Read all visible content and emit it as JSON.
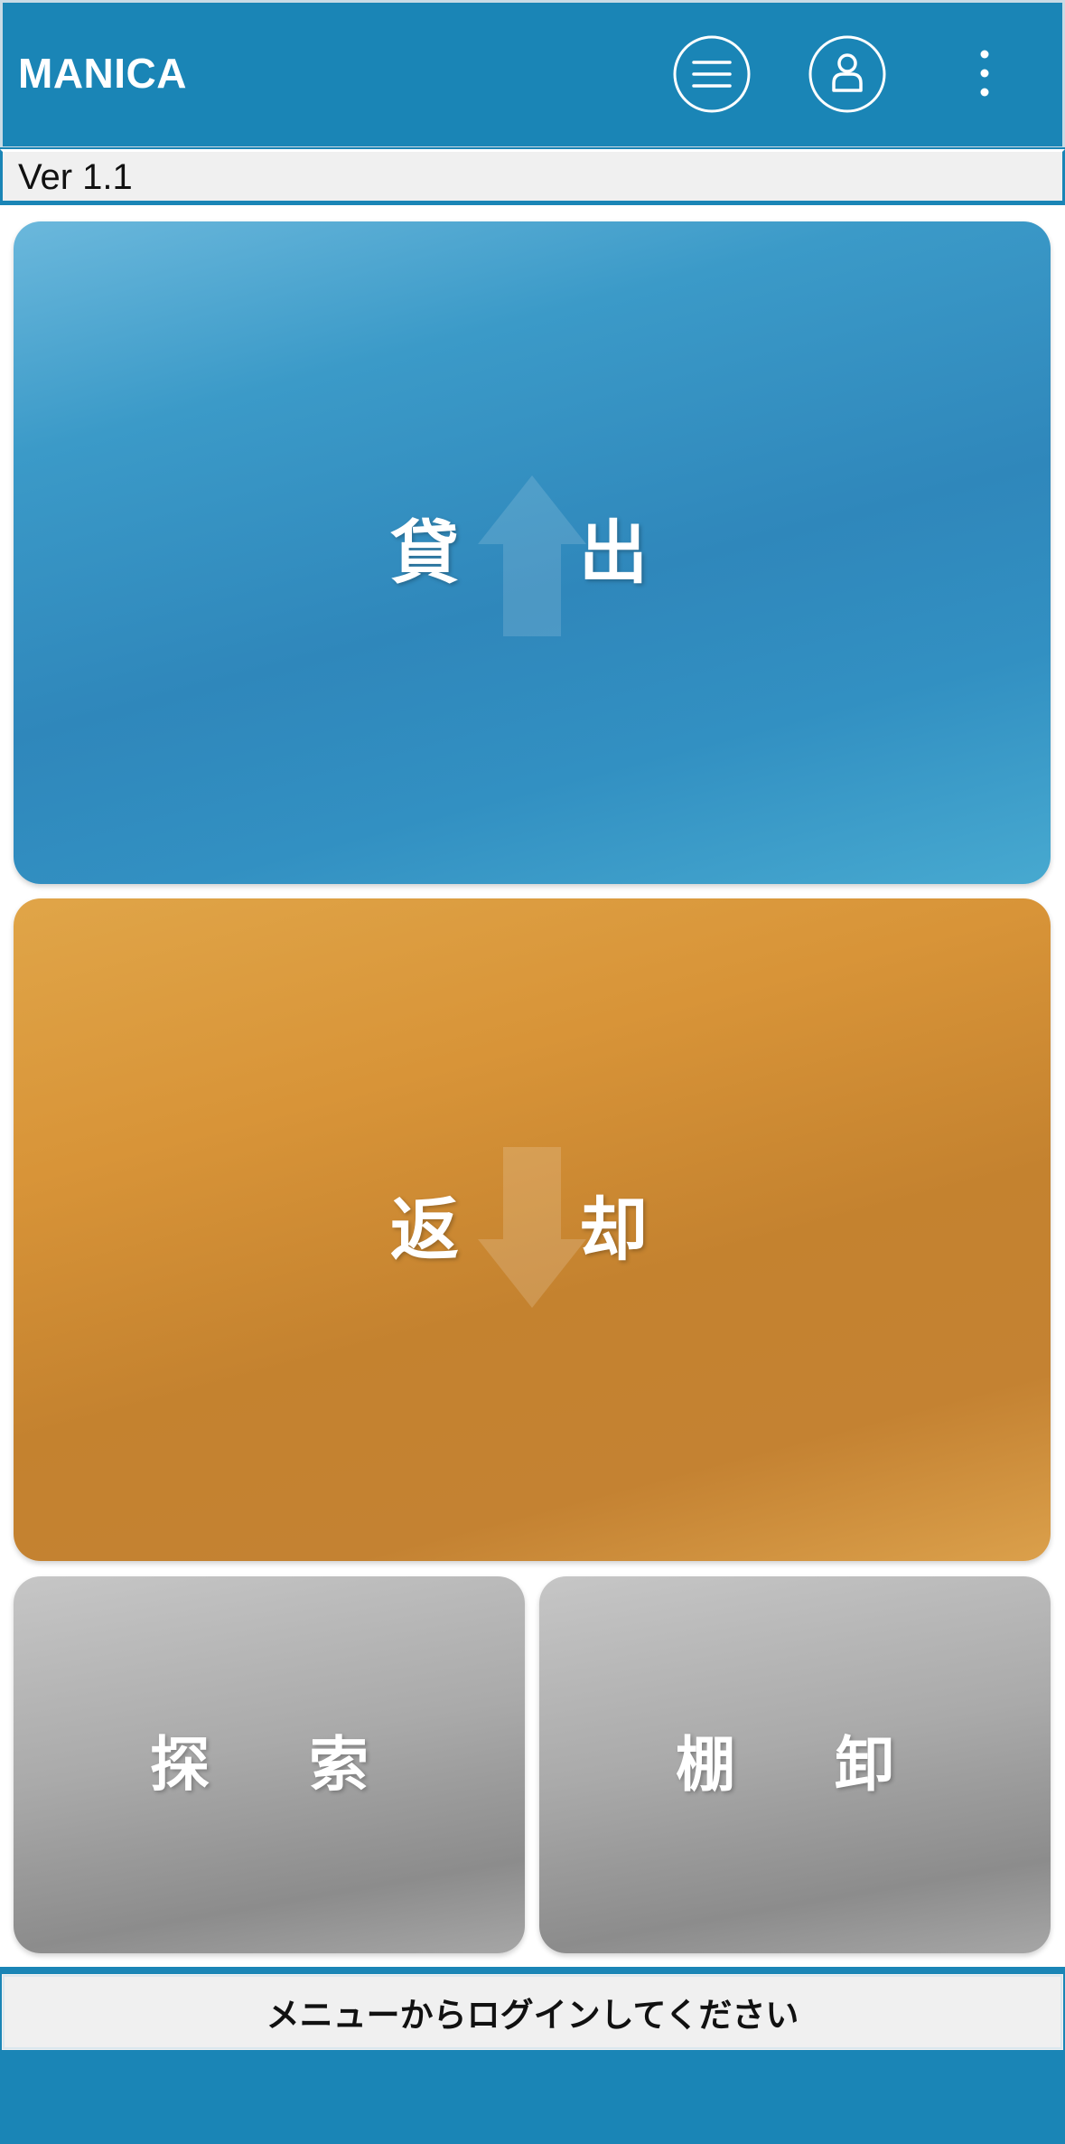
{
  "header": {
    "title": "MANICA",
    "buttons": [
      {
        "icon": "hamburger-menu-icon"
      },
      {
        "icon": "user-account-icon"
      },
      {
        "icon": "more-vertical-icon"
      }
    ],
    "color": "#1a85b6"
  },
  "version": {
    "text": "Ver 1.1"
  },
  "tiles": {
    "lend": {
      "char1": "貸",
      "char2": "出",
      "icon": "arrow-up-icon",
      "color": "#2f87bb"
    },
    "return": {
      "char1": "返",
      "char2": "却",
      "icon": "arrow-down-icon",
      "color": "#c4822f"
    },
    "search": {
      "char1": "探",
      "char2": "索",
      "color": "#aaaaaa"
    },
    "stocktake": {
      "char1": "棚",
      "char2": "卸",
      "color": "#aaaaaa"
    }
  },
  "status": {
    "message": "メニューからログインしてください"
  }
}
